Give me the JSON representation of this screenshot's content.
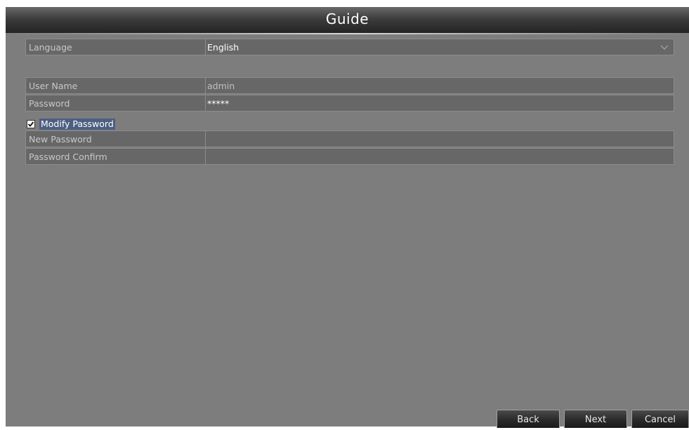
{
  "window": {
    "title": "Guide"
  },
  "language": {
    "label": "Language",
    "value": "English"
  },
  "account": {
    "user_name_label": "User Name",
    "user_name_value": "admin",
    "password_label": "Password",
    "password_value": "*****"
  },
  "modify_password": {
    "label": "Modify Password",
    "checked": true,
    "new_password_label": "New Password",
    "new_password_value": "",
    "confirm_label": "Password Confirm",
    "confirm_value": ""
  },
  "buttons": {
    "back": "Back",
    "next": "Next",
    "cancel": "Cancel"
  },
  "colors": {
    "panel": "#7d7d7d",
    "field": "#676767",
    "title_bar": "#2a2a2a",
    "checkbox_highlight": "#4c5f82"
  }
}
